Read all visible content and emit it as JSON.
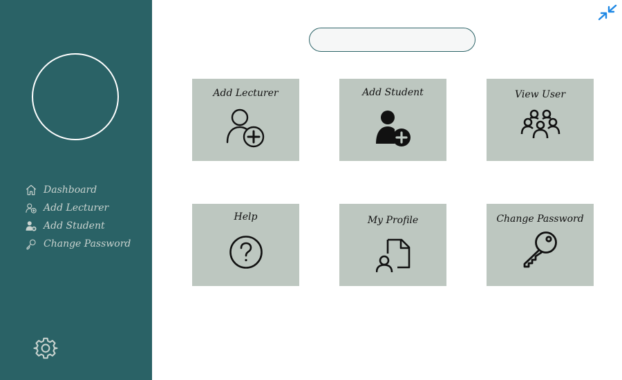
{
  "sidebar": {
    "nav": [
      {
        "label": "Dashboard",
        "icon": "home-icon"
      },
      {
        "label": "Add Lecturer",
        "icon": "add-user-outline-icon"
      },
      {
        "label": "Add Student",
        "icon": "add-user-filled-icon"
      },
      {
        "label": "Change Password",
        "icon": "key-icon"
      }
    ],
    "settings_icon": "gear-icon"
  },
  "header": {
    "collapse_icon": "collapse-arrows-icon",
    "search_placeholder": ""
  },
  "tiles": [
    {
      "label": "Add Lecturer",
      "icon": "add-user-outline-icon"
    },
    {
      "label": "Add Student",
      "icon": "add-user-filled-icon"
    },
    {
      "label": "View User",
      "icon": "users-group-icon"
    },
    {
      "label": "Help",
      "icon": "help-icon"
    },
    {
      "label": "My Profile",
      "icon": "profile-file-icon"
    },
    {
      "label": "Change Password",
      "icon": "key-icon"
    }
  ],
  "colors": {
    "sidebar_bg": "#2a6266",
    "tile_bg": "#bdc7c0",
    "nav_text": "#c9d3cf",
    "accent": "#1e88e5"
  }
}
